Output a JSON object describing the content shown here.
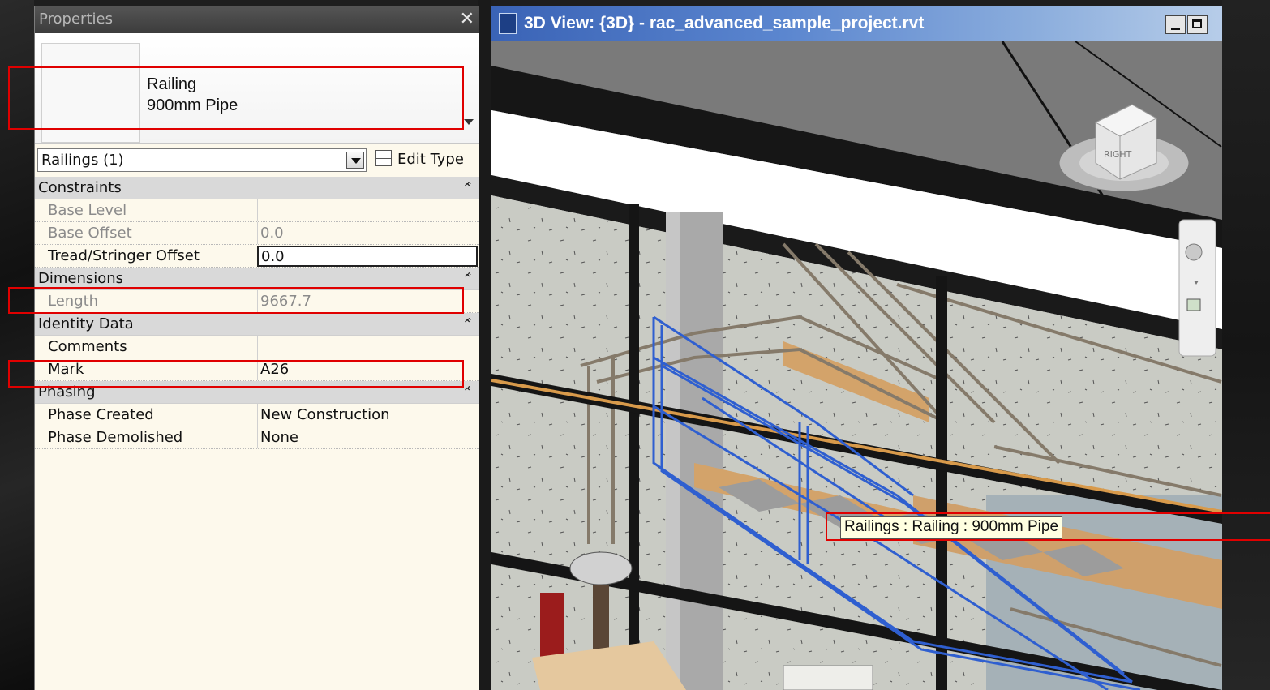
{
  "properties_panel": {
    "title": "Properties",
    "close_glyph": "✕",
    "type_selector": {
      "family": "Railing",
      "type": "900mm Pipe"
    },
    "filter": {
      "selected": "Railings (1)"
    },
    "edit_type_label": "Edit Type",
    "groups": [
      {
        "name": "Constraints",
        "rows": [
          {
            "label": "Base Level",
            "value": "",
            "state": "disabled"
          },
          {
            "label": "Base Offset",
            "value": "0.0",
            "state": "disabled"
          },
          {
            "label": "Tread/Stringer Offset",
            "value": "0.0",
            "state": "editing"
          }
        ]
      },
      {
        "name": "Dimensions",
        "rows": [
          {
            "label": "Length",
            "value": "9667.7",
            "state": "disabled"
          }
        ]
      },
      {
        "name": "Identity Data",
        "rows": [
          {
            "label": "Comments",
            "value": "",
            "state": "normal"
          },
          {
            "label": "Mark",
            "value": "A26",
            "state": "normal"
          }
        ]
      },
      {
        "name": "Phasing",
        "rows": [
          {
            "label": "Phase Created",
            "value": "New Construction",
            "state": "normal"
          },
          {
            "label": "Phase Demolished",
            "value": "None",
            "state": "normal"
          }
        ]
      }
    ]
  },
  "view_window": {
    "title": "3D View: {3D} - rac_advanced_sample_project.rvt",
    "tooltip": "Railings : Railing : 900mm Pipe",
    "viewcube_face": "RIGHT"
  },
  "colors": {
    "highlight": "#e00000",
    "selection": "#2f5fd0",
    "title_bar_start": "#3a63b6"
  }
}
